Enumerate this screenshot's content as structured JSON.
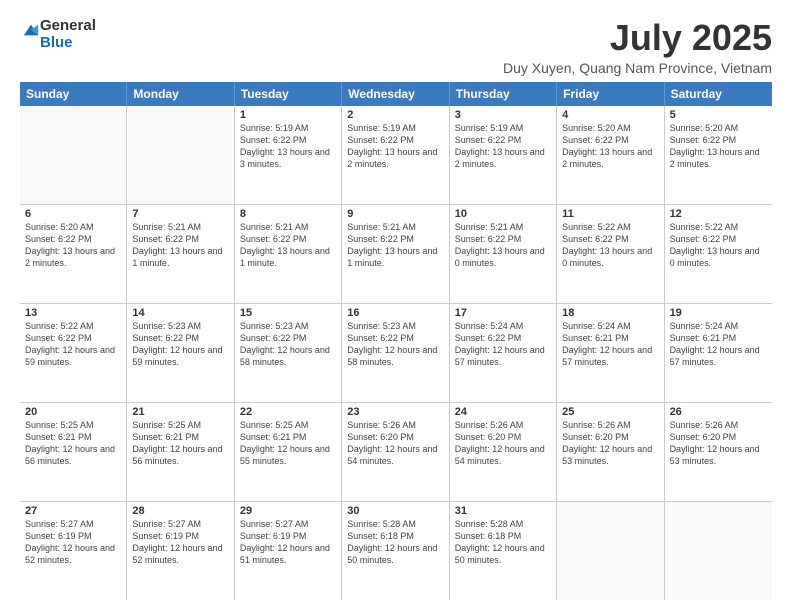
{
  "logo": {
    "general": "General",
    "blue": "Blue"
  },
  "title": "July 2025",
  "subtitle": "Duy Xuyen, Quang Nam Province, Vietnam",
  "headers": [
    "Sunday",
    "Monday",
    "Tuesday",
    "Wednesday",
    "Thursday",
    "Friday",
    "Saturday"
  ],
  "weeks": [
    [
      {
        "day": "",
        "text": ""
      },
      {
        "day": "",
        "text": ""
      },
      {
        "day": "1",
        "text": "Sunrise: 5:19 AM\nSunset: 6:22 PM\nDaylight: 13 hours and 3 minutes."
      },
      {
        "day": "2",
        "text": "Sunrise: 5:19 AM\nSunset: 6:22 PM\nDaylight: 13 hours and 2 minutes."
      },
      {
        "day": "3",
        "text": "Sunrise: 5:19 AM\nSunset: 6:22 PM\nDaylight: 13 hours and 2 minutes."
      },
      {
        "day": "4",
        "text": "Sunrise: 5:20 AM\nSunset: 6:22 PM\nDaylight: 13 hours and 2 minutes."
      },
      {
        "day": "5",
        "text": "Sunrise: 5:20 AM\nSunset: 6:22 PM\nDaylight: 13 hours and 2 minutes."
      }
    ],
    [
      {
        "day": "6",
        "text": "Sunrise: 5:20 AM\nSunset: 6:22 PM\nDaylight: 13 hours and 2 minutes."
      },
      {
        "day": "7",
        "text": "Sunrise: 5:21 AM\nSunset: 6:22 PM\nDaylight: 13 hours and 1 minute."
      },
      {
        "day": "8",
        "text": "Sunrise: 5:21 AM\nSunset: 6:22 PM\nDaylight: 13 hours and 1 minute."
      },
      {
        "day": "9",
        "text": "Sunrise: 5:21 AM\nSunset: 6:22 PM\nDaylight: 13 hours and 1 minute."
      },
      {
        "day": "10",
        "text": "Sunrise: 5:21 AM\nSunset: 6:22 PM\nDaylight: 13 hours and 0 minutes."
      },
      {
        "day": "11",
        "text": "Sunrise: 5:22 AM\nSunset: 6:22 PM\nDaylight: 13 hours and 0 minutes."
      },
      {
        "day": "12",
        "text": "Sunrise: 5:22 AM\nSunset: 6:22 PM\nDaylight: 13 hours and 0 minutes."
      }
    ],
    [
      {
        "day": "13",
        "text": "Sunrise: 5:22 AM\nSunset: 6:22 PM\nDaylight: 12 hours and 59 minutes."
      },
      {
        "day": "14",
        "text": "Sunrise: 5:23 AM\nSunset: 6:22 PM\nDaylight: 12 hours and 59 minutes."
      },
      {
        "day": "15",
        "text": "Sunrise: 5:23 AM\nSunset: 6:22 PM\nDaylight: 12 hours and 58 minutes."
      },
      {
        "day": "16",
        "text": "Sunrise: 5:23 AM\nSunset: 6:22 PM\nDaylight: 12 hours and 58 minutes."
      },
      {
        "day": "17",
        "text": "Sunrise: 5:24 AM\nSunset: 6:22 PM\nDaylight: 12 hours and 57 minutes."
      },
      {
        "day": "18",
        "text": "Sunrise: 5:24 AM\nSunset: 6:21 PM\nDaylight: 12 hours and 57 minutes."
      },
      {
        "day": "19",
        "text": "Sunrise: 5:24 AM\nSunset: 6:21 PM\nDaylight: 12 hours and 57 minutes."
      }
    ],
    [
      {
        "day": "20",
        "text": "Sunrise: 5:25 AM\nSunset: 6:21 PM\nDaylight: 12 hours and 56 minutes."
      },
      {
        "day": "21",
        "text": "Sunrise: 5:25 AM\nSunset: 6:21 PM\nDaylight: 12 hours and 56 minutes."
      },
      {
        "day": "22",
        "text": "Sunrise: 5:25 AM\nSunset: 6:21 PM\nDaylight: 12 hours and 55 minutes."
      },
      {
        "day": "23",
        "text": "Sunrise: 5:26 AM\nSunset: 6:20 PM\nDaylight: 12 hours and 54 minutes."
      },
      {
        "day": "24",
        "text": "Sunrise: 5:26 AM\nSunset: 6:20 PM\nDaylight: 12 hours and 54 minutes."
      },
      {
        "day": "25",
        "text": "Sunrise: 5:26 AM\nSunset: 6:20 PM\nDaylight: 12 hours and 53 minutes."
      },
      {
        "day": "26",
        "text": "Sunrise: 5:26 AM\nSunset: 6:20 PM\nDaylight: 12 hours and 53 minutes."
      }
    ],
    [
      {
        "day": "27",
        "text": "Sunrise: 5:27 AM\nSunset: 6:19 PM\nDaylight: 12 hours and 52 minutes."
      },
      {
        "day": "28",
        "text": "Sunrise: 5:27 AM\nSunset: 6:19 PM\nDaylight: 12 hours and 52 minutes."
      },
      {
        "day": "29",
        "text": "Sunrise: 5:27 AM\nSunset: 6:19 PM\nDaylight: 12 hours and 51 minutes."
      },
      {
        "day": "30",
        "text": "Sunrise: 5:28 AM\nSunset: 6:18 PM\nDaylight: 12 hours and 50 minutes."
      },
      {
        "day": "31",
        "text": "Sunrise: 5:28 AM\nSunset: 6:18 PM\nDaylight: 12 hours and 50 minutes."
      },
      {
        "day": "",
        "text": ""
      },
      {
        "day": "",
        "text": ""
      }
    ]
  ]
}
